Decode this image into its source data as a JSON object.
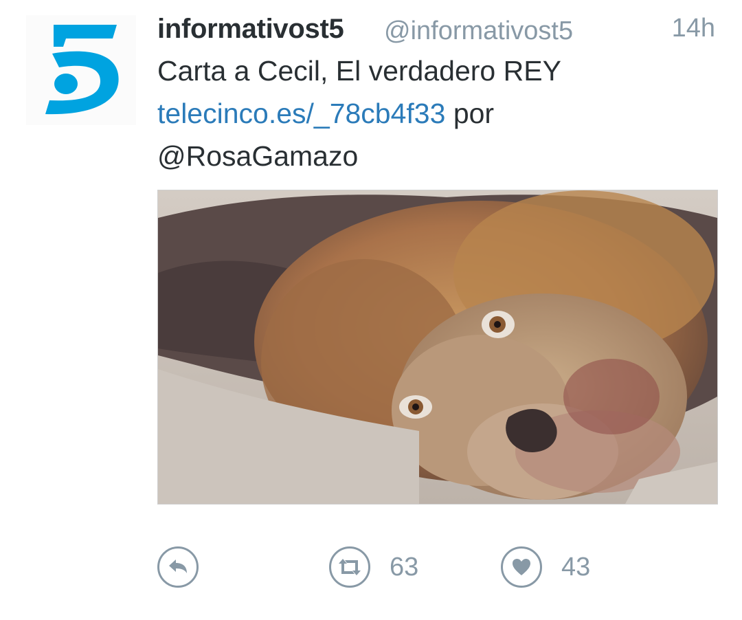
{
  "tweet": {
    "display_name": "informativost5",
    "screen_name": "@informativost5",
    "timestamp": "14h",
    "text_line1": "Carta a Cecil, El verdadero REY",
    "link": "telecinco.es/_78cb4f33",
    "text_by": " por",
    "mention": "@RosaGamazo"
  },
  "avatar": {
    "icon": "telecinco-logo-icon",
    "color": "#00a3e0"
  },
  "media": {
    "icon": "lion-photo"
  },
  "actions": {
    "reply": {
      "icon": "reply-icon",
      "count": ""
    },
    "retweet": {
      "icon": "retweet-icon",
      "count": "63"
    },
    "like": {
      "icon": "heart-icon",
      "count": "43"
    }
  },
  "colors": {
    "text": "#292f33",
    "muted": "#8899a6",
    "link": "#2b7bb9"
  }
}
